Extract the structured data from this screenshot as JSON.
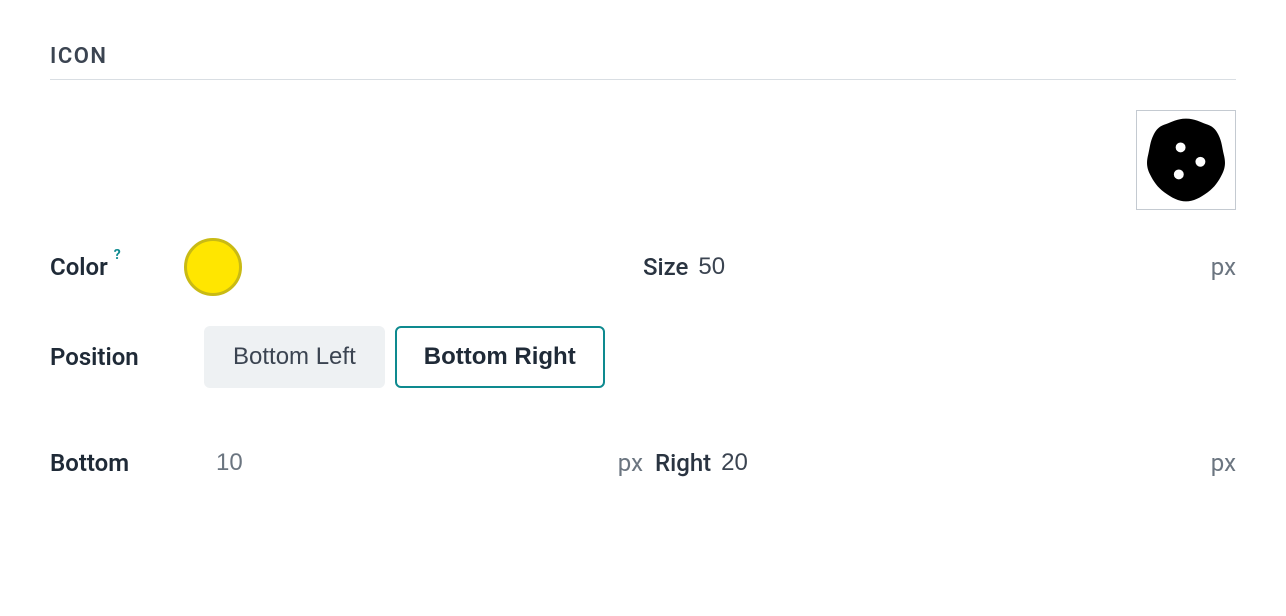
{
  "section": {
    "title": "ICON"
  },
  "color": {
    "label": "Color",
    "help": "?",
    "value": "#ffe600"
  },
  "size": {
    "label": "Size",
    "value": "50",
    "unit": "px"
  },
  "position": {
    "label": "Position",
    "options": {
      "bottom_left": "Bottom Left",
      "bottom_right": "Bottom Right"
    },
    "selected": "bottom_right"
  },
  "offset": {
    "bottom_label": "Bottom",
    "bottom_value": "10",
    "bottom_unit": "px",
    "right_label": "Right",
    "right_value": "20",
    "right_unit": "px"
  },
  "preview_icon": "cookie-icon"
}
